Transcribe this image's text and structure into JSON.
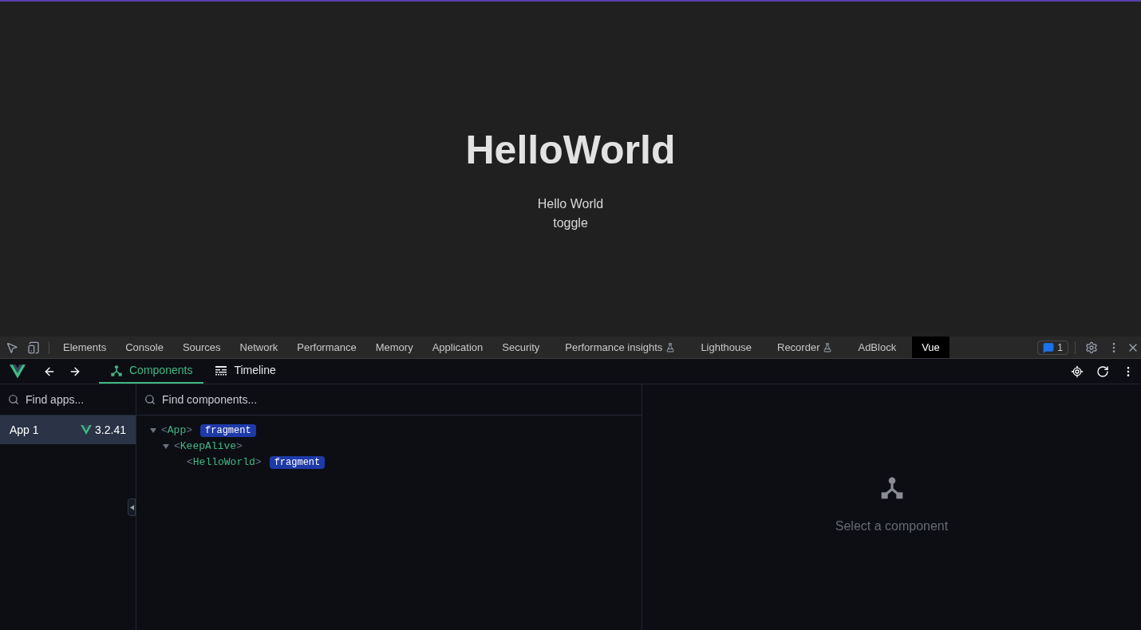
{
  "page": {
    "heading": "HelloWorld",
    "message": "Hello World",
    "toggle": "toggle"
  },
  "devtools": {
    "tabs": [
      {
        "label": "Elements",
        "experimental": false,
        "selected": false
      },
      {
        "label": "Console",
        "experimental": false,
        "selected": false
      },
      {
        "label": "Sources",
        "experimental": false,
        "selected": false
      },
      {
        "label": "Network",
        "experimental": false,
        "selected": false
      },
      {
        "label": "Performance",
        "experimental": false,
        "selected": false
      },
      {
        "label": "Memory",
        "experimental": false,
        "selected": false
      },
      {
        "label": "Application",
        "experimental": false,
        "selected": false
      },
      {
        "label": "Security",
        "experimental": false,
        "selected": false
      },
      {
        "label": "Performance insights",
        "experimental": true,
        "selected": false
      },
      {
        "label": "Lighthouse",
        "experimental": false,
        "selected": false
      },
      {
        "label": "Recorder",
        "experimental": true,
        "selected": false
      },
      {
        "label": "AdBlock",
        "experimental": false,
        "selected": false
      },
      {
        "label": "Vue",
        "experimental": false,
        "selected": true
      }
    ],
    "issues_count": "1"
  },
  "vue": {
    "nav_tabs": [
      {
        "label": "Components",
        "kind": "components",
        "selected": true
      },
      {
        "label": "Timeline",
        "kind": "timeline",
        "selected": false
      }
    ],
    "apps_search": {
      "placeholder": "Find apps..."
    },
    "apps": [
      {
        "name": "App 1",
        "version": "3.2.41",
        "selected": true
      }
    ],
    "components_search": {
      "placeholder": "Find components..."
    },
    "tree": [
      {
        "tag": "<App>",
        "badge": "fragment",
        "expanded": true,
        "children": [
          {
            "tag": "<KeepAlive>",
            "expanded": true,
            "children": [
              {
                "tag": "<HelloWorld>",
                "badge": "fragment"
              }
            ]
          }
        ]
      }
    ],
    "inspector_empty": "Select a component"
  }
}
